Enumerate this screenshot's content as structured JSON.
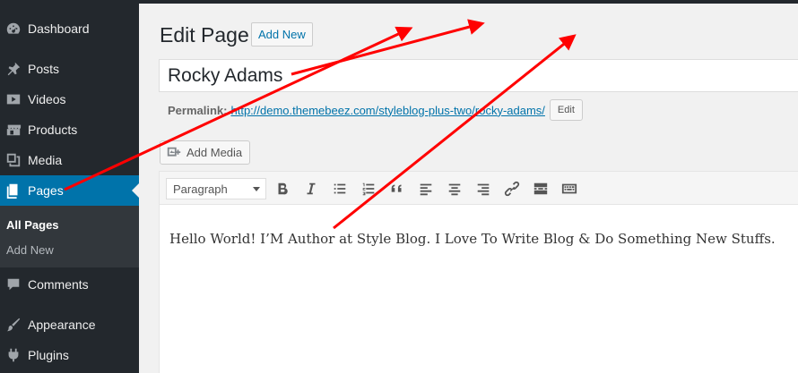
{
  "sidebar": {
    "items": [
      {
        "label": "Dashboard",
        "icon": "dashboard-icon"
      },
      {
        "label": "Posts",
        "icon": "pin-icon"
      },
      {
        "label": "Videos",
        "icon": "video-icon"
      },
      {
        "label": "Products",
        "icon": "store-icon"
      },
      {
        "label": "Media",
        "icon": "media-icon"
      },
      {
        "label": "Pages",
        "icon": "page-icon",
        "active": true
      },
      {
        "label": "Comments",
        "icon": "comment-icon"
      },
      {
        "label": "Appearance",
        "icon": "brush-icon"
      },
      {
        "label": "Plugins",
        "icon": "plugin-icon"
      }
    ],
    "submenu": [
      {
        "label": "All Pages",
        "current": true
      },
      {
        "label": "Add New"
      }
    ]
  },
  "header": {
    "title": "Edit Page",
    "add_new_label": "Add New"
  },
  "editor": {
    "title_value": "Rocky Adams",
    "permalink_label": "Permalink:",
    "permalink_url": "http://demo.themebeez.com/styleblog-plus-two/rocky-adams/",
    "permalink_edit_label": "Edit",
    "add_media_label": "Add Media",
    "format_value": "Paragraph",
    "body_text": "Hello World! I’M Author at Style Blog. I Love To Write Blog & Do Something New Stuffs."
  },
  "colors": {
    "sidebar_bg": "#23282d",
    "active_bg": "#0073aa",
    "annotation_arrow": "#ff0000"
  }
}
